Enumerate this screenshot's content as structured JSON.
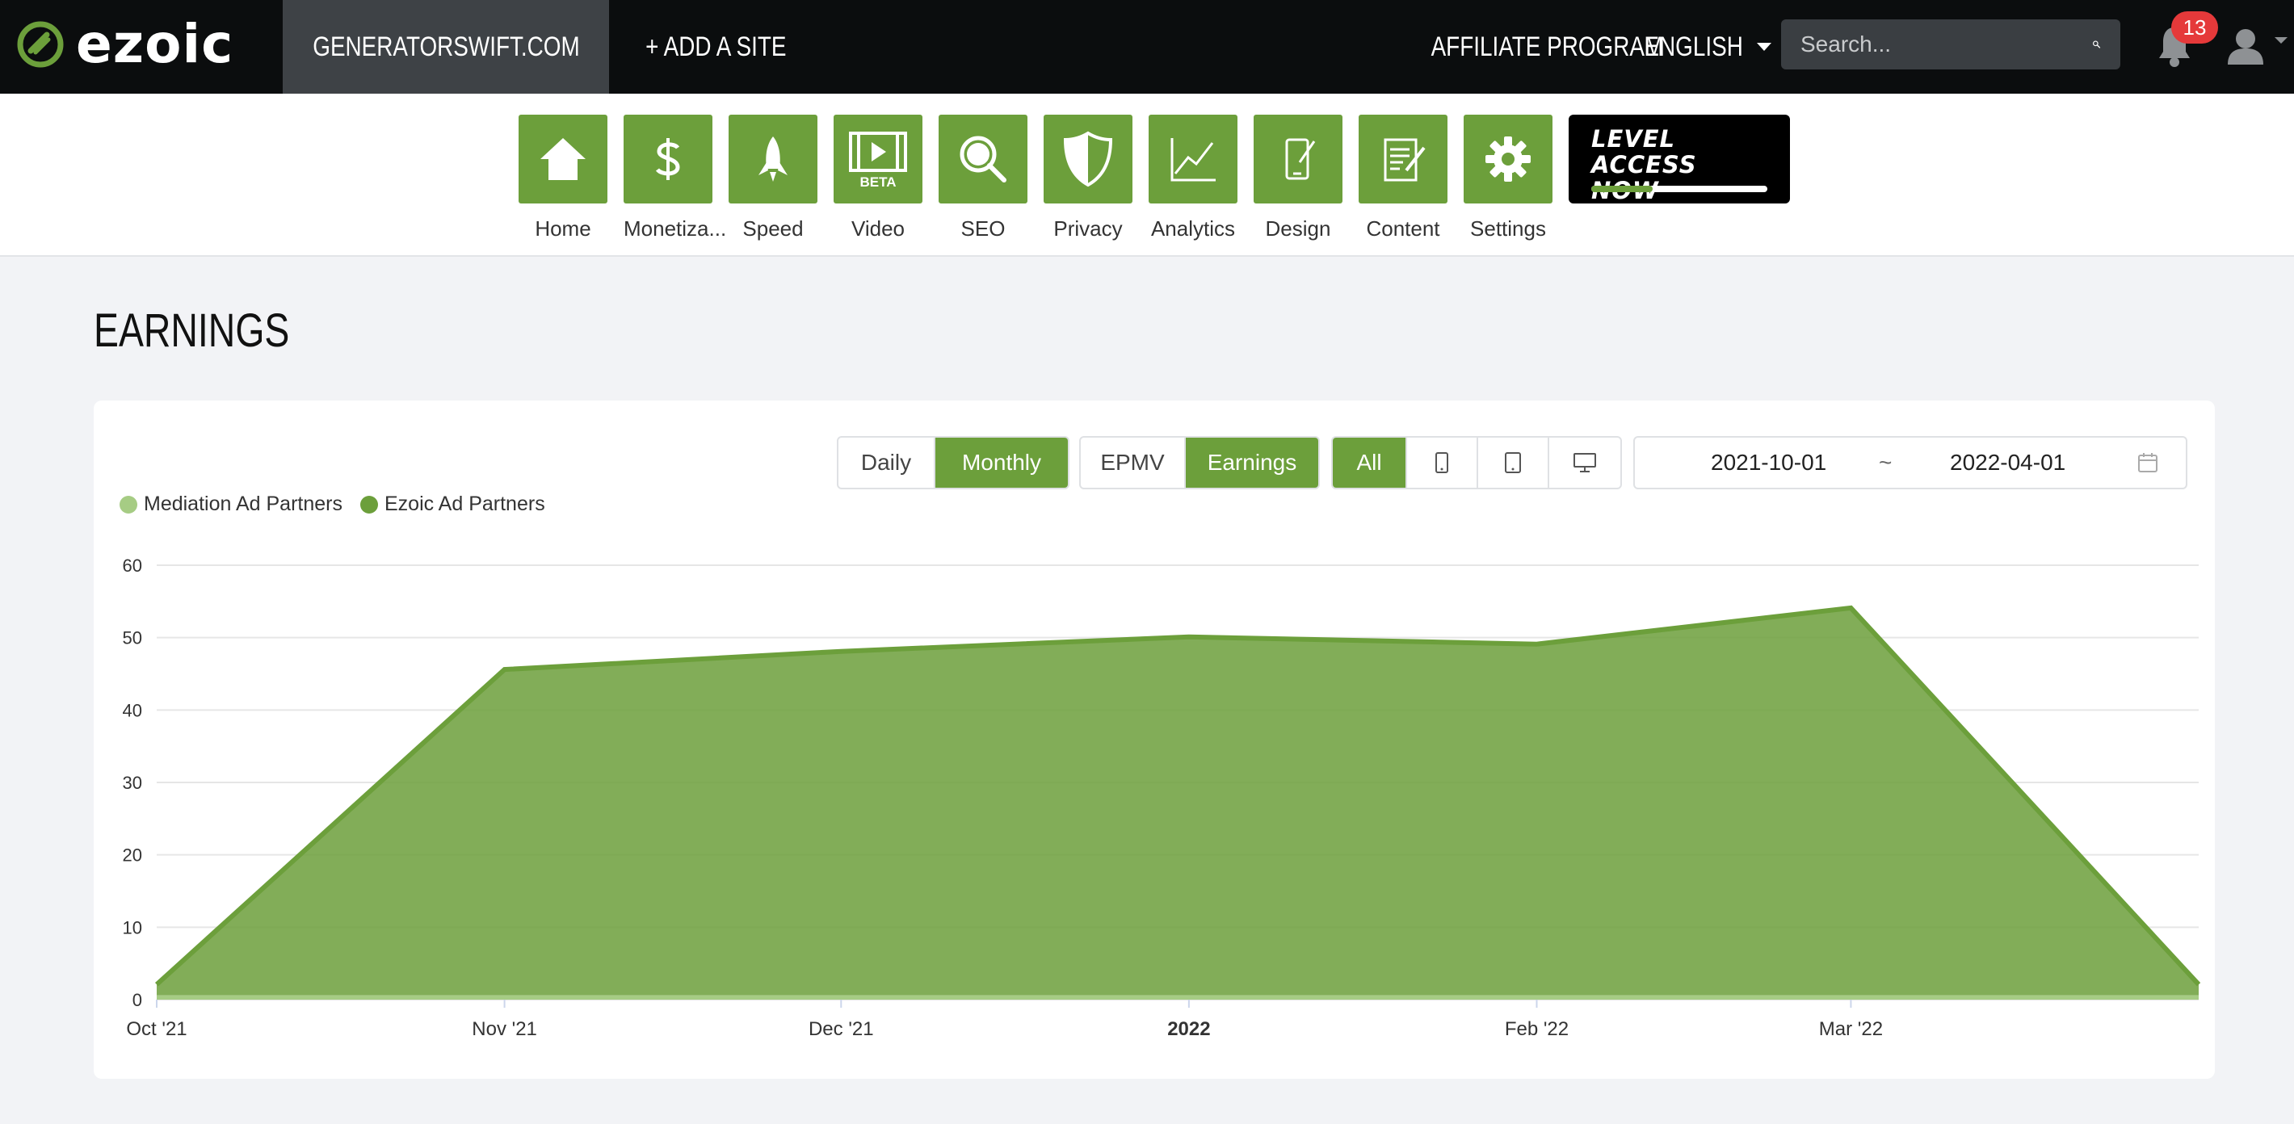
{
  "brand": {
    "logo_text": "ezoic",
    "accent": "#6c9f3b",
    "topbar_bg": "#0b0d0e"
  },
  "topbar": {
    "site_name": "GENERATORSWIFT.COM",
    "add_site": "+ ADD A SITE",
    "affiliate": "AFFILIATE PROGRAM",
    "language": "ENGLISH",
    "search_placeholder": "Search...",
    "notifications": "13"
  },
  "toolbar": {
    "items": [
      {
        "label": "Home",
        "icon": "home-icon"
      },
      {
        "label": "Monetiza...",
        "icon": "dollar-icon"
      },
      {
        "label": "Speed",
        "icon": "rocket-icon"
      },
      {
        "label": "Video",
        "icon": "video-beta-icon",
        "badge": "BETA"
      },
      {
        "label": "SEO",
        "icon": "magnifier-icon"
      },
      {
        "label": "Privacy",
        "icon": "shield-icon"
      },
      {
        "label": "Analytics",
        "icon": "line-chart-icon"
      },
      {
        "label": "Design",
        "icon": "phone-pen-icon"
      },
      {
        "label": "Content",
        "icon": "document-pen-icon"
      },
      {
        "label": "Settings",
        "icon": "gear-icon"
      }
    ],
    "level": {
      "line1": "LEVEL",
      "line2": "ACCESS NOW",
      "progress_green": 0.35,
      "progress_total": 0.75
    }
  },
  "page": {
    "title": "EARNINGS"
  },
  "controls": {
    "period": [
      "Daily",
      "Monthly"
    ],
    "period_active": "Monthly",
    "metric": [
      "EPMV",
      "Earnings"
    ],
    "metric_active": "Earnings",
    "device_all": "All",
    "device_icons": [
      "mobile-icon",
      "tablet-icon",
      "desktop-icon"
    ],
    "date_from": "2021-10-01",
    "date_sep": "~",
    "date_to": "2022-04-01"
  },
  "chart_data": {
    "type": "area",
    "legend": [
      "Mediation Ad Partners",
      "Ezoic Ad Partners"
    ],
    "x": [
      "2021-10-01",
      "2021-11-01",
      "2021-12-01",
      "2022-01-01",
      "2022-02-01",
      "2022-03-01",
      "2022-04-01"
    ],
    "x_ticks": [
      {
        "label": "Oct '21",
        "date": "2021-10-01",
        "bold": false
      },
      {
        "label": "Nov '21",
        "date": "2021-11-01",
        "bold": false
      },
      {
        "label": "Dec '21",
        "date": "2021-12-01",
        "bold": false
      },
      {
        "label": "2022",
        "date": "2022-01-01",
        "bold": true
      },
      {
        "label": "Feb '22",
        "date": "2022-02-01",
        "bold": false
      },
      {
        "label": "Mar '22",
        "date": "2022-03-01",
        "bold": false
      }
    ],
    "series": [
      {
        "name": "Mediation Ad Partners",
        "color": "#a6cc84",
        "values": [
          0.6,
          0.6,
          0.6,
          0.6,
          0.6,
          0.6,
          0.6
        ]
      },
      {
        "name": "Ezoic Ad Partners",
        "color": "#6c9f3b",
        "values": [
          1.5,
          45,
          47.5,
          49.5,
          48.5,
          53.5,
          1.5
        ]
      }
    ],
    "ylim": [
      0,
      60
    ],
    "y_ticks": [
      0,
      10,
      20,
      30,
      40,
      50,
      60
    ],
    "stacked": true,
    "grid": true,
    "legend_position": "top-left"
  }
}
